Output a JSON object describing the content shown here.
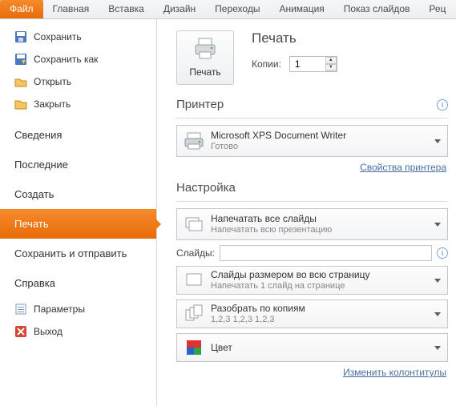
{
  "ribbon": {
    "tabs": [
      "Файл",
      "Главная",
      "Вставка",
      "Дизайн",
      "Переходы",
      "Анимация",
      "Показ слайдов",
      "Рец"
    ]
  },
  "backstage": {
    "items_top": [
      {
        "label": "Сохранить"
      },
      {
        "label": "Сохранить как"
      },
      {
        "label": "Открыть"
      },
      {
        "label": "Закрыть"
      }
    ],
    "items_main": [
      {
        "label": "Сведения"
      },
      {
        "label": "Последние"
      },
      {
        "label": "Создать"
      },
      {
        "label": "Печать"
      },
      {
        "label": "Сохранить и отправить"
      },
      {
        "label": "Справка"
      }
    ],
    "items_bottom": [
      {
        "label": "Параметры"
      },
      {
        "label": "Выход"
      }
    ]
  },
  "pane": {
    "print_section_title": "Печать",
    "print_button_label": "Печать",
    "copies_label": "Копии:",
    "copies_value": "1",
    "printer_heading": "Принтер",
    "printer": {
      "name": "Microsoft XPS Document Writer",
      "status": "Готово"
    },
    "printer_properties_link": "Свойства принтера",
    "settings_heading": "Настройка",
    "print_what": {
      "t1": "Напечатать все слайды",
      "t2": "Напечатать всю презентацию"
    },
    "slides_label": "Слайды:",
    "slides_value": "",
    "layout": {
      "t1": "Слайды размером во всю страницу",
      "t2": "Напечатать 1 слайд на странице"
    },
    "collate": {
      "t1": "Разобрать по копиям",
      "t2": "1,2,3    1,2,3    1,2,3"
    },
    "color": {
      "t1": "Цвет"
    },
    "footer_link": "Изменить колонтитулы"
  }
}
